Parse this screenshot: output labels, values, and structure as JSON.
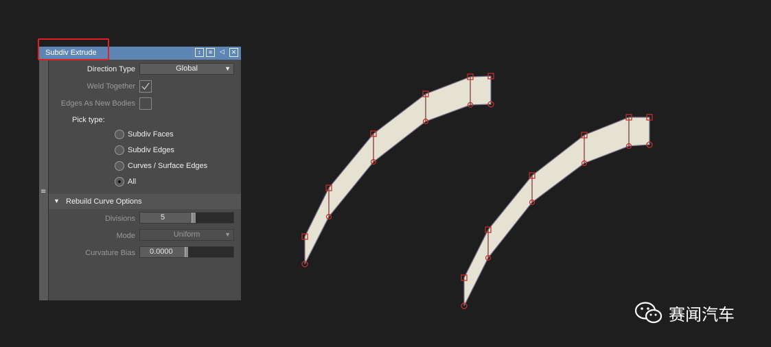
{
  "window": {
    "title": "Subdiv Extrude",
    "title_bar_color": "#5e86b4"
  },
  "options": {
    "direction_type": {
      "label": "Direction Type",
      "value": "Global"
    },
    "weld_together": {
      "label": "Weld Together",
      "checked": true
    },
    "edges_as_new_bodies": {
      "label": "Edges As New Bodies",
      "checked": false
    },
    "pick_type": {
      "label": "Pick type:",
      "items": [
        {
          "label": "Subdiv Faces",
          "selected": false
        },
        {
          "label": "Subdiv Edges",
          "selected": false
        },
        {
          "label": "Curves / Surface Edges",
          "selected": false
        },
        {
          "label": "All",
          "selected": true
        }
      ]
    }
  },
  "rebuild_curve_options": {
    "header": "Rebuild Curve Options",
    "divisions": {
      "label": "Divisions",
      "value": "5"
    },
    "mode": {
      "label": "Mode",
      "value": "Uniform"
    },
    "curvature_bias": {
      "label": "Curvature Bias",
      "value": "0.0000"
    }
  },
  "watermark": {
    "text": "赛闻汽车",
    "icon": "wechat-icon"
  },
  "colors": {
    "surface_fill": "#e6e2d3",
    "cv_marker": "#c0302a",
    "highlight_box": "#e02020"
  }
}
